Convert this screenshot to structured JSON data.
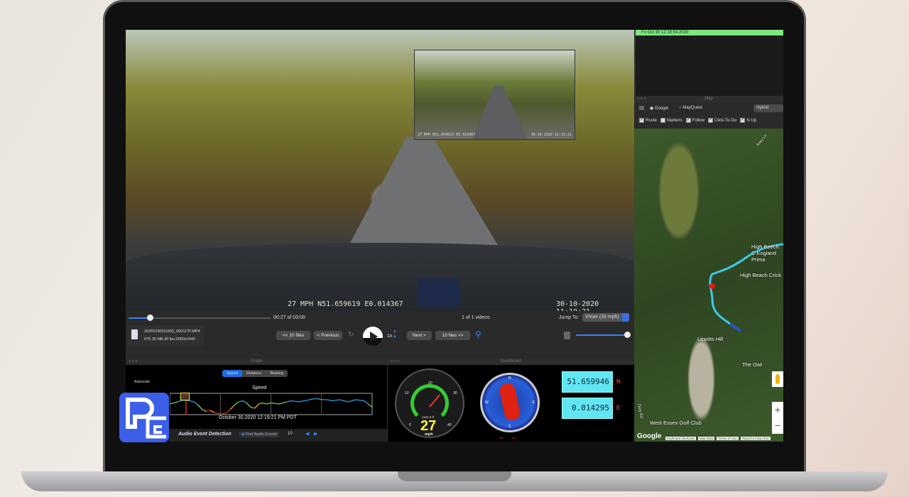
{
  "video": {
    "osd_left": "27 MPH N51.659619 E0.014367",
    "osd_right": "30-10-2020  11:19:21",
    "pip_left": "27 MPH N51.659619 E0.014367",
    "pip_right": "30-10-2020 11:19:21"
  },
  "controls": {
    "time": "00:27 of 03:00",
    "video_count": "1 of 1 videos",
    "jump_label": "Jump To:",
    "jump_value": "Vmax (33 mph)",
    "file_name": "20201030111655_000117F.MP4",
    "file_info": "676.35 MB,30 fps,2560x1440",
    "prev10": "<< 10 files",
    "prev": "< Previous",
    "speed": "1x",
    "next": "Next >",
    "next10": "10 files >>",
    "progress": 0.15,
    "volume": 1.0
  },
  "graph": {
    "title": "Graph",
    "tabs": [
      "Speed",
      "Distance",
      "Bearing"
    ],
    "active_tab": "Speed",
    "autoscale": "Autoscale",
    "chart_title": "Speed",
    "marker_value": "27",
    "timestamp": "October 30,2020 12:19:21 PM PDT",
    "audio_label": "Audio Event Detection",
    "find_audio": "Find Audio Events",
    "threshold": "10",
    "chart_data": {
      "type": "line",
      "title": "Speed",
      "values": [
        20,
        22,
        24,
        27,
        27,
        26,
        24,
        18,
        10,
        6,
        8,
        4,
        2,
        2,
        3,
        10,
        18,
        24,
        26,
        22,
        14,
        12,
        20,
        22,
        20,
        22,
        21,
        20,
        22,
        24,
        26,
        25,
        24,
        26,
        27,
        29,
        30,
        29,
        28,
        28,
        26,
        27,
        28,
        26,
        24,
        26,
        28,
        27,
        26,
        20,
        14
      ],
      "ylim": [
        0,
        40
      ]
    }
  },
  "dashboard": {
    "title": "Dashboard",
    "speed": "27",
    "unit": "mph",
    "altitude": "1162.8 ft",
    "gauge_ticks": [
      "0",
      "10",
      "20",
      "30",
      "40"
    ],
    "compass": [
      "N",
      "E",
      "S",
      "W"
    ],
    "lat": "51.659946",
    "lat_dir": "N",
    "lon": "0.014295",
    "lon_dir": "E"
  },
  "right_top": {
    "timestamp": "Fri Oct 30 12:18:54 2020"
  },
  "map": {
    "title": "Map",
    "providers": [
      "Google",
      "MapQuest"
    ],
    "selected_provider": "Google",
    "map_type": "Hybrid",
    "options": [
      {
        "label": "Route",
        "checked": true
      },
      {
        "label": "Markers",
        "checked": false
      },
      {
        "label": "Follow",
        "checked": true
      },
      {
        "label": "Click-To-Go",
        "checked": true
      },
      {
        "label": "N Up",
        "checked": true
      }
    ],
    "labels": [
      "High Beech C England Prima",
      "High Beach Crick",
      "Lippitts Hill",
      "The Owl",
      "West Essex Golf Club",
      "Avey Ln",
      "Dury Rd"
    ],
    "brand": "Google",
    "footer": [
      "Keyboard shortcuts",
      "Map Data",
      "Terms of Use",
      "Report a map error"
    ],
    "zoom_in": "+",
    "zoom_out": "−"
  }
}
